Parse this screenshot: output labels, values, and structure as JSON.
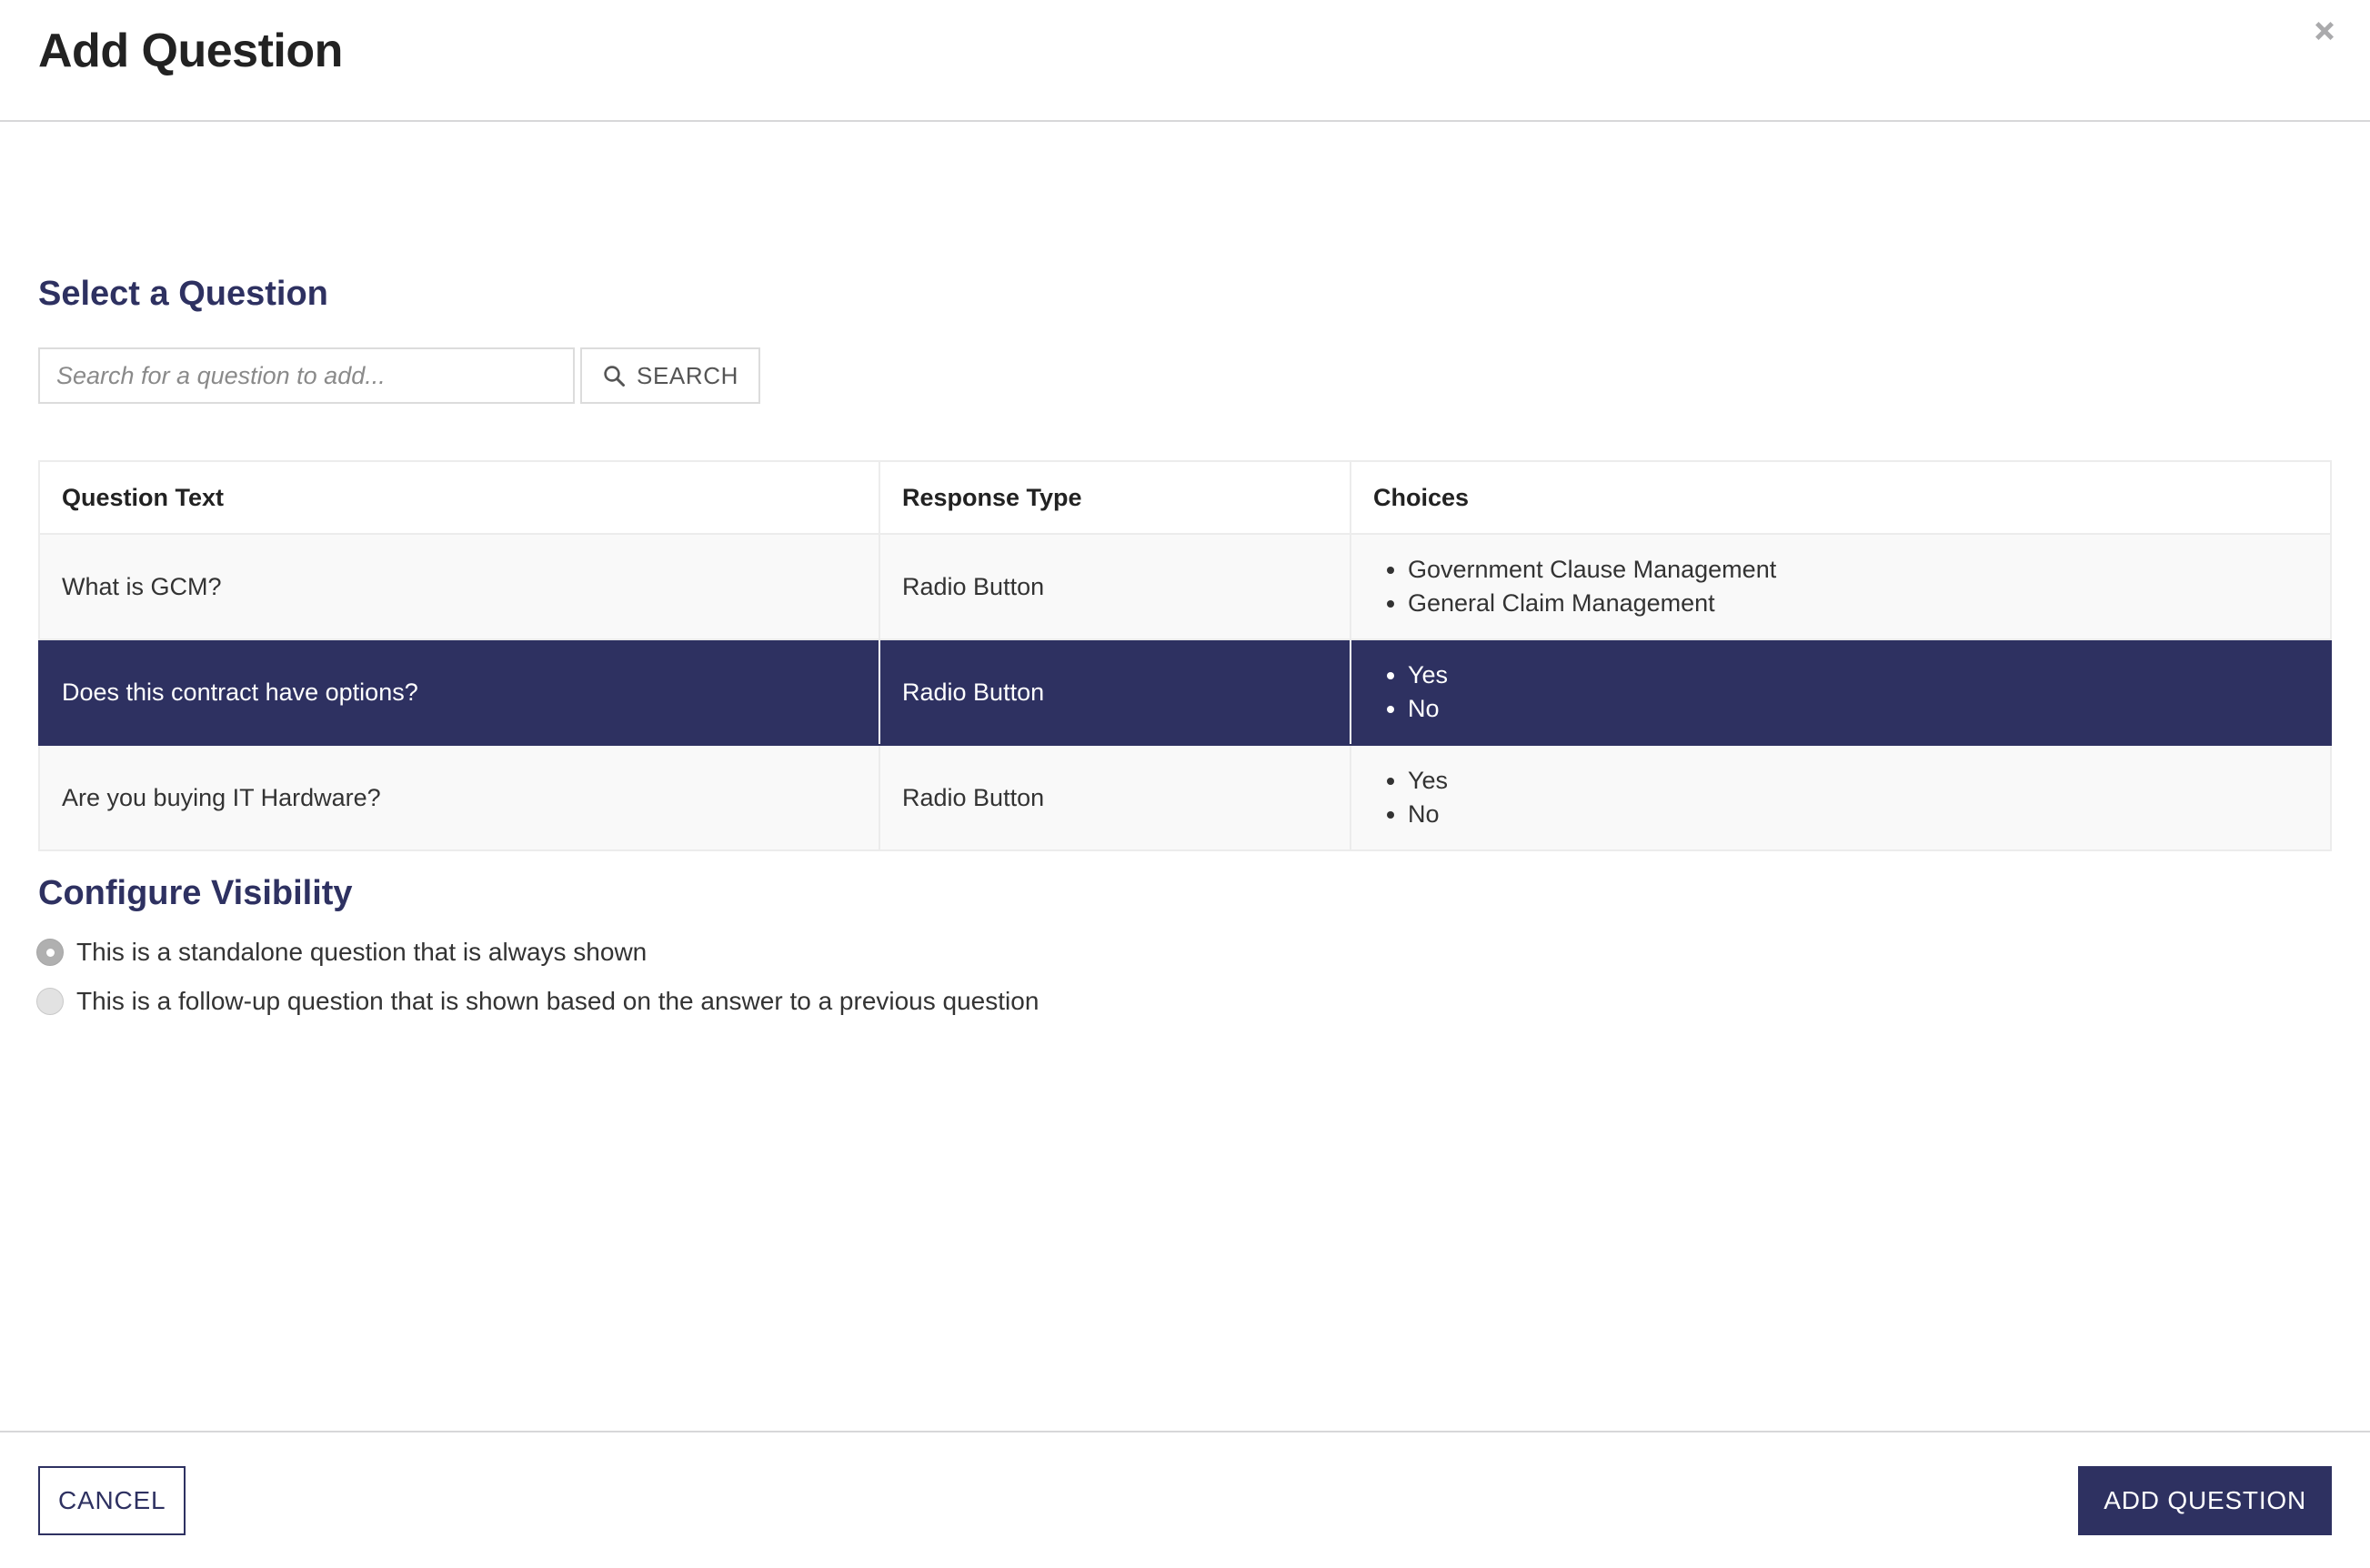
{
  "modal": {
    "title": "Add Question",
    "close_icon": "close-icon"
  },
  "colors": {
    "brand_navy": "#2e3161",
    "row_selected_bg": "#2e3161",
    "row_bg": "#f9f9f9",
    "border": "#ececec",
    "divider": "#d7d7d9",
    "radio_on": "#b0b0b0",
    "radio_off": "#e2e2e2"
  },
  "select_question": {
    "heading": "Select a Question",
    "search": {
      "placeholder": "Search for a question to add...",
      "value": "",
      "button_label": "SEARCH",
      "button_icon": "search-icon"
    },
    "table": {
      "columns": [
        "Question Text",
        "Response Type",
        "Choices"
      ],
      "rows": [
        {
          "question_text": "What is GCM?",
          "response_type": "Radio Button",
          "choices": [
            "Government Clause Management",
            "General Claim Management"
          ],
          "selected": false
        },
        {
          "question_text": "Does this contract have options?",
          "response_type": "Radio Button",
          "choices": [
            "Yes",
            "No"
          ],
          "selected": true
        },
        {
          "question_text": "Are you buying IT Hardware?",
          "response_type": "Radio Button",
          "choices": [
            "Yes",
            "No"
          ],
          "selected": false
        }
      ]
    }
  },
  "configure_visibility": {
    "heading": "Configure Visibility",
    "options": [
      {
        "label": "This is a standalone question that is always shown",
        "selected": true
      },
      {
        "label": "This is a follow-up question that is shown based on the answer to a previous question",
        "selected": false
      }
    ]
  },
  "footer": {
    "cancel_label": "CANCEL",
    "add_label": "ADD QUESTION"
  }
}
